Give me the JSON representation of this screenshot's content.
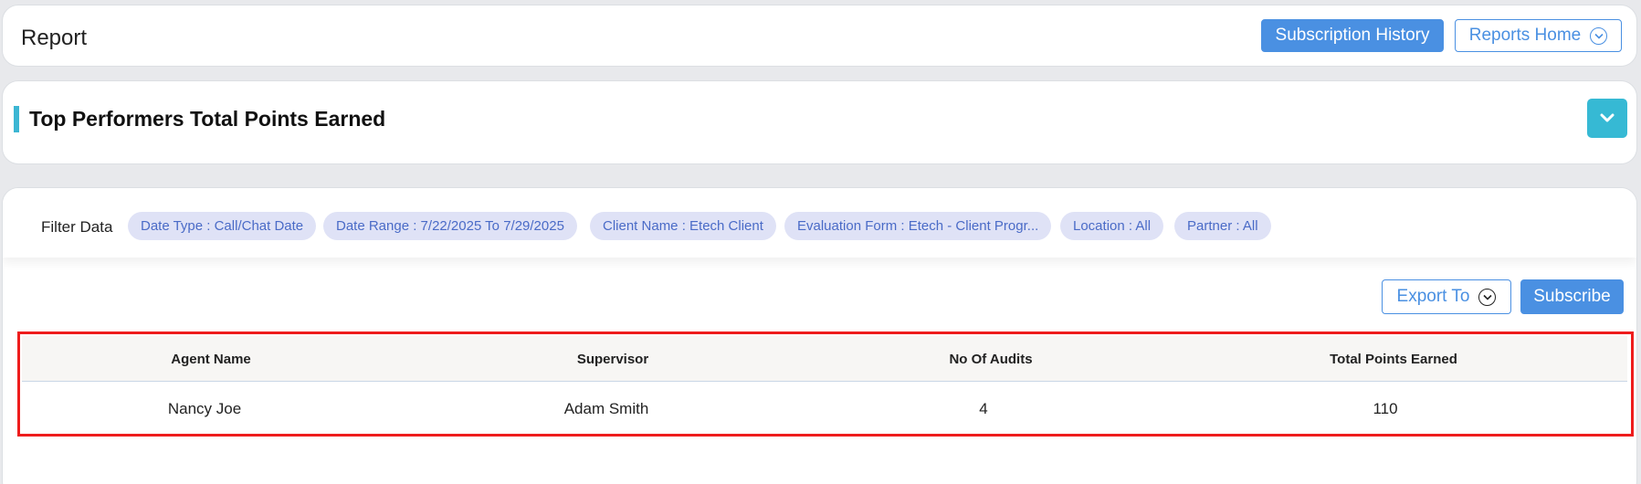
{
  "header": {
    "title": "Report",
    "subscription_history_label": "Subscription History",
    "reports_home_label": "Reports Home"
  },
  "section": {
    "title": "Top Performers Total Points Earned"
  },
  "filters": {
    "label": "Filter Data",
    "chips": [
      "Date Type : Call/Chat Date",
      "Date Range : 7/22/2025 To 7/29/2025",
      "Client Name : Etech Client",
      "Evaluation Form : Etech - Client Progr...",
      "Location : All",
      "Partner : All"
    ]
  },
  "actions": {
    "export_label": "Export To",
    "subscribe_label": "Subscribe"
  },
  "table": {
    "columns": [
      "Agent Name",
      "Supervisor",
      "No Of Audits",
      "Total Points Earned"
    ],
    "rows": [
      [
        "Nancy Joe",
        "Adam Smith",
        "4",
        "110"
      ]
    ]
  },
  "colors": {
    "primary": "#4a90e2",
    "accent": "#36b9d4",
    "highlight_border": "#ee1c1c",
    "chip_bg": "#dfe2f6"
  }
}
